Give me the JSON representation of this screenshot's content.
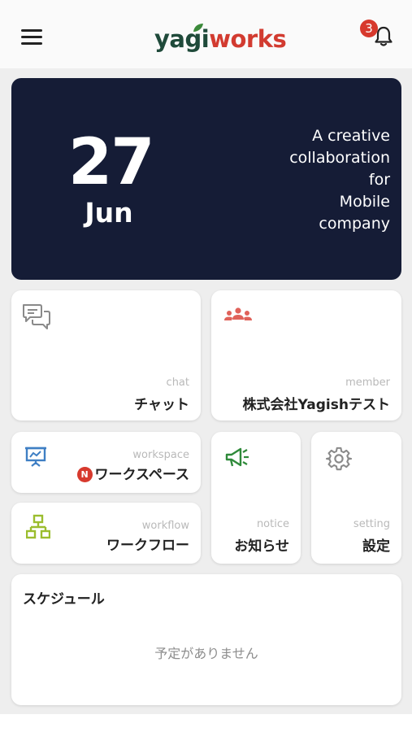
{
  "header": {
    "logo_part1": "yagi",
    "logo_part2": "works",
    "notification_count": "3"
  },
  "hero": {
    "day": "27",
    "month": "Jun",
    "tagline": "A creative\ncollaboration\nfor\nMobile\ncompany"
  },
  "tiles": {
    "chat": {
      "sub": "chat",
      "label": "チャット"
    },
    "member": {
      "sub": "member",
      "label": "株式会社Yagishテスト"
    },
    "workspace": {
      "sub": "workspace",
      "badge": "N",
      "label": "ワークスペース"
    },
    "workflow": {
      "sub": "workflow",
      "label": "ワークフロー"
    },
    "notice": {
      "sub": "notice",
      "label": "お知らせ"
    },
    "setting": {
      "sub": "setting",
      "label": "設定"
    }
  },
  "schedule": {
    "title": "スケジュール",
    "empty": "予定がありません"
  },
  "colors": {
    "hero_bg": "#151c36",
    "logo_green": "#1f4a3a",
    "logo_red": "#d23b30",
    "badge_red": "#d7392d",
    "member_icon": "#e0625a",
    "workspace_icon": "#3f7fc4",
    "workflow_icon": "#9bbd2e",
    "notice_icon": "#2f8a3a",
    "setting_icon": "#8a8a8a"
  },
  "icons": {
    "menu": "hamburger-icon",
    "bell": "bell-icon",
    "chat": "chat-bubbles-icon",
    "member": "group-icon",
    "workspace": "presentation-board-icon",
    "workflow": "org-chart-icon",
    "notice": "megaphone-icon",
    "setting": "gear-icon"
  }
}
